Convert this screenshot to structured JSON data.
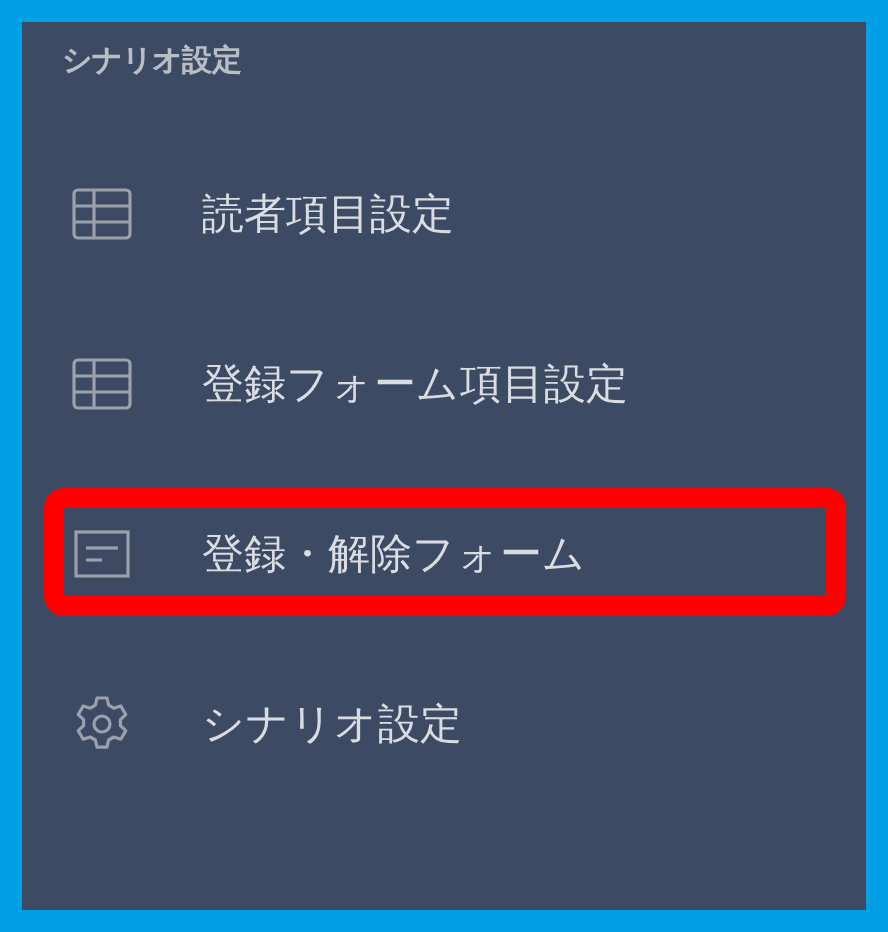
{
  "sidebar": {
    "heading": "シナリオ設定",
    "items": [
      {
        "label": "読者項目設定",
        "kind": "table",
        "highlighted": false
      },
      {
        "label": "登録フォーム項目設定",
        "kind": "table",
        "highlighted": false
      },
      {
        "label": "登録・解除フォーム",
        "kind": "form",
        "highlighted": true
      },
      {
        "label": "シナリオ設定",
        "kind": "gear",
        "highlighted": false
      }
    ]
  }
}
